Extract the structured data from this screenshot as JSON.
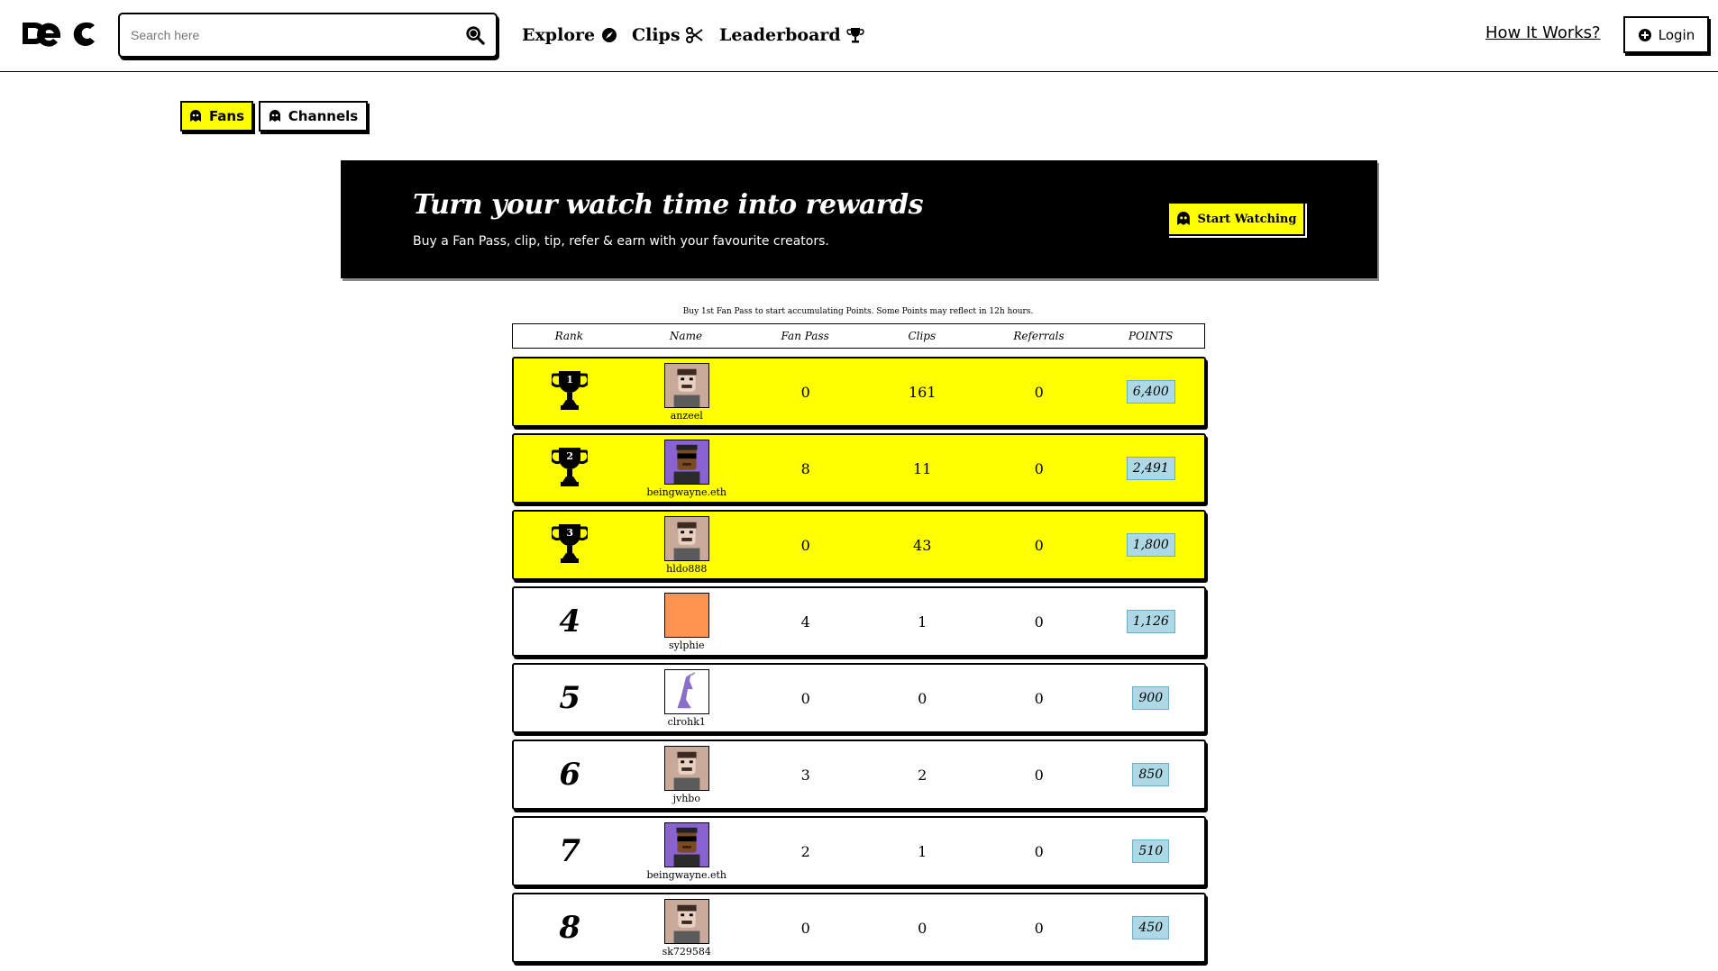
{
  "header": {
    "search_placeholder": "Search here",
    "nav": [
      {
        "label": "Explore",
        "icon": "compass-icon"
      },
      {
        "label": "Clips",
        "icon": "scissors-icon"
      },
      {
        "label": "Leaderboard",
        "icon": "trophy-icon"
      }
    ],
    "how_it_works": "How It Works?",
    "login": "Login"
  },
  "tabs": [
    {
      "label": "Fans",
      "active": true
    },
    {
      "label": "Channels",
      "active": false
    }
  ],
  "banner": {
    "title": "Turn your watch time into rewards",
    "subtitle": "Buy a Fan Pass, clip, tip, refer & earn with your favourite creators.",
    "cta": "Start Watching"
  },
  "note": "Buy 1st Fan Pass to start accumulating Points. Some Points may reflect in 12h hours.",
  "table": {
    "headers": [
      "Rank",
      "Name",
      "Fan Pass",
      "Clips",
      "Referrals",
      "POINTS"
    ],
    "rows": [
      {
        "rank": "1",
        "name": "anzeel",
        "avatar": "man-avatar",
        "fan_pass": "0",
        "clips": "161",
        "referrals": "0",
        "points": "6,400"
      },
      {
        "rank": "2",
        "name": "beingwayne.eth",
        "avatar": "sunglasses-avatar",
        "fan_pass": "8",
        "clips": "11",
        "referrals": "0",
        "points": "2,491"
      },
      {
        "rank": "3",
        "name": "hldo888",
        "avatar": "man-avatar",
        "fan_pass": "0",
        "clips": "43",
        "referrals": "0",
        "points": "1,800"
      },
      {
        "rank": "4",
        "name": "sylphie",
        "avatar": "orange-avatar",
        "fan_pass": "4",
        "clips": "1",
        "referrals": "0",
        "points": "1,126"
      },
      {
        "rank": "5",
        "name": "clrohk1",
        "avatar": "figure-avatar",
        "fan_pass": "0",
        "clips": "0",
        "referrals": "0",
        "points": "900"
      },
      {
        "rank": "6",
        "name": "jvhbo",
        "avatar": "man-avatar",
        "fan_pass": "3",
        "clips": "2",
        "referrals": "0",
        "points": "850"
      },
      {
        "rank": "7",
        "name": "beingwayne.eth",
        "avatar": "sunglasses-avatar",
        "fan_pass": "2",
        "clips": "1",
        "referrals": "0",
        "points": "510"
      },
      {
        "rank": "8",
        "name": "sk729584",
        "avatar": "man-avatar",
        "fan_pass": "0",
        "clips": "0",
        "referrals": "0",
        "points": "450"
      }
    ]
  },
  "colors": {
    "highlight": "#ffff00",
    "points_badge": "#add8e6"
  }
}
